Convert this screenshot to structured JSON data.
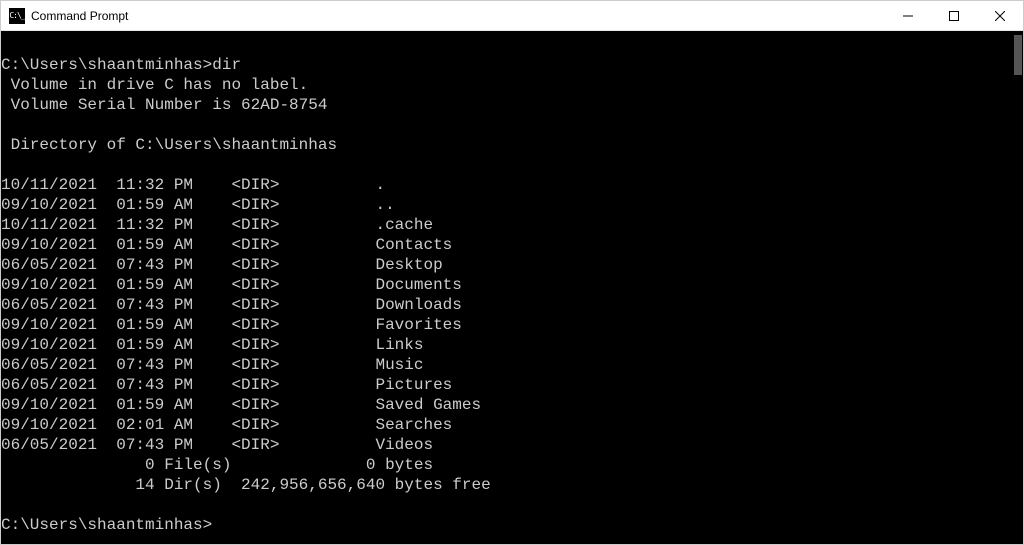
{
  "window": {
    "title": "Command Prompt",
    "icon_label": "C:\\_"
  },
  "prompt": {
    "path": "C:\\Users\\shaantminhas",
    "command": "dir"
  },
  "volume": {
    "label_line": " Volume in drive C has no label.",
    "serial_line": " Volume Serial Number is 62AD-8754"
  },
  "directory_header": " Directory of C:\\Users\\shaantminhas",
  "listing": [
    {
      "date": "10/11/2021",
      "time": "11:32 PM",
      "type": "<DIR>",
      "name": "."
    },
    {
      "date": "09/10/2021",
      "time": "01:59 AM",
      "type": "<DIR>",
      "name": ".."
    },
    {
      "date": "10/11/2021",
      "time": "11:32 PM",
      "type": "<DIR>",
      "name": ".cache"
    },
    {
      "date": "09/10/2021",
      "time": "01:59 AM",
      "type": "<DIR>",
      "name": "Contacts"
    },
    {
      "date": "06/05/2021",
      "time": "07:43 PM",
      "type": "<DIR>",
      "name": "Desktop"
    },
    {
      "date": "09/10/2021",
      "time": "01:59 AM",
      "type": "<DIR>",
      "name": "Documents"
    },
    {
      "date": "06/05/2021",
      "time": "07:43 PM",
      "type": "<DIR>",
      "name": "Downloads"
    },
    {
      "date": "09/10/2021",
      "time": "01:59 AM",
      "type": "<DIR>",
      "name": "Favorites"
    },
    {
      "date": "09/10/2021",
      "time": "01:59 AM",
      "type": "<DIR>",
      "name": "Links"
    },
    {
      "date": "06/05/2021",
      "time": "07:43 PM",
      "type": "<DIR>",
      "name": "Music"
    },
    {
      "date": "06/05/2021",
      "time": "07:43 PM",
      "type": "<DIR>",
      "name": "Pictures"
    },
    {
      "date": "09/10/2021",
      "time": "01:59 AM",
      "type": "<DIR>",
      "name": "Saved Games"
    },
    {
      "date": "09/10/2021",
      "time": "02:01 AM",
      "type": "<DIR>",
      "name": "Searches"
    },
    {
      "date": "06/05/2021",
      "time": "07:43 PM",
      "type": "<DIR>",
      "name": "Videos"
    }
  ],
  "summary": {
    "files_line": "               0 File(s)              0 bytes",
    "dirs_line": "              14 Dir(s)  242,956,656,640 bytes free"
  },
  "prompt2": "C:\\Users\\shaantminhas>"
}
